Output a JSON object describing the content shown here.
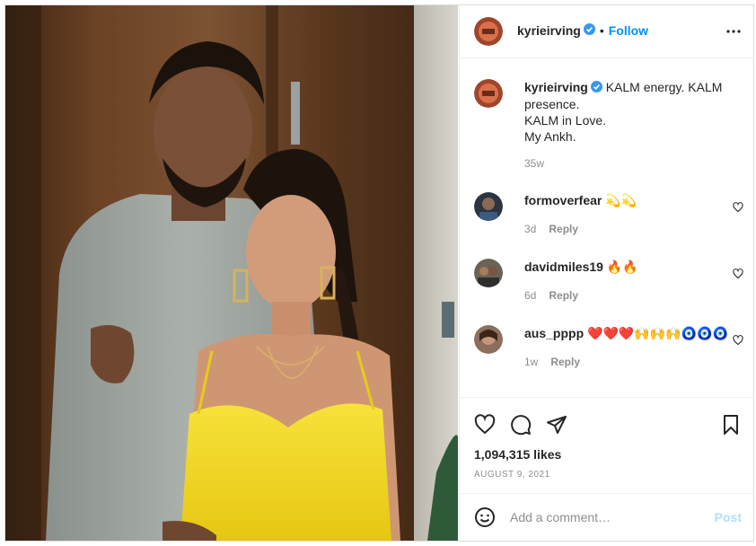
{
  "post": {
    "username": "kyrieirving",
    "verified": true,
    "follow_label": "Follow",
    "caption_lines": [
      "KALM energy. KALM presence.",
      "KALM in Love.",
      "My Ankh."
    ],
    "caption_age": "35w"
  },
  "comments": [
    {
      "user": "formoverfear",
      "emoji": "💫💫",
      "age": "3d",
      "reply": "Reply"
    },
    {
      "user": "davidmiles19",
      "emoji": "🔥🔥",
      "age": "6d",
      "reply": "Reply"
    },
    {
      "user": "aus_pppp",
      "emoji": "❤️❤️❤️🙌🙌🙌🧿🧿🧿",
      "age": "1w",
      "reply": "Reply"
    }
  ],
  "engagement": {
    "likes": "1,094,315 likes",
    "date": "AUGUST 9, 2021"
  },
  "composer": {
    "placeholder": "Add a comment…",
    "post_label": "Post"
  },
  "icons": [
    "verified-badge-icon",
    "more-options-icon",
    "heart-icon",
    "comment-icon",
    "share-icon",
    "bookmark-icon",
    "emoji-icon"
  ],
  "colors": {
    "accent": "#0095f6",
    "verified": "#3897f0",
    "dress": "#f2d81c"
  }
}
